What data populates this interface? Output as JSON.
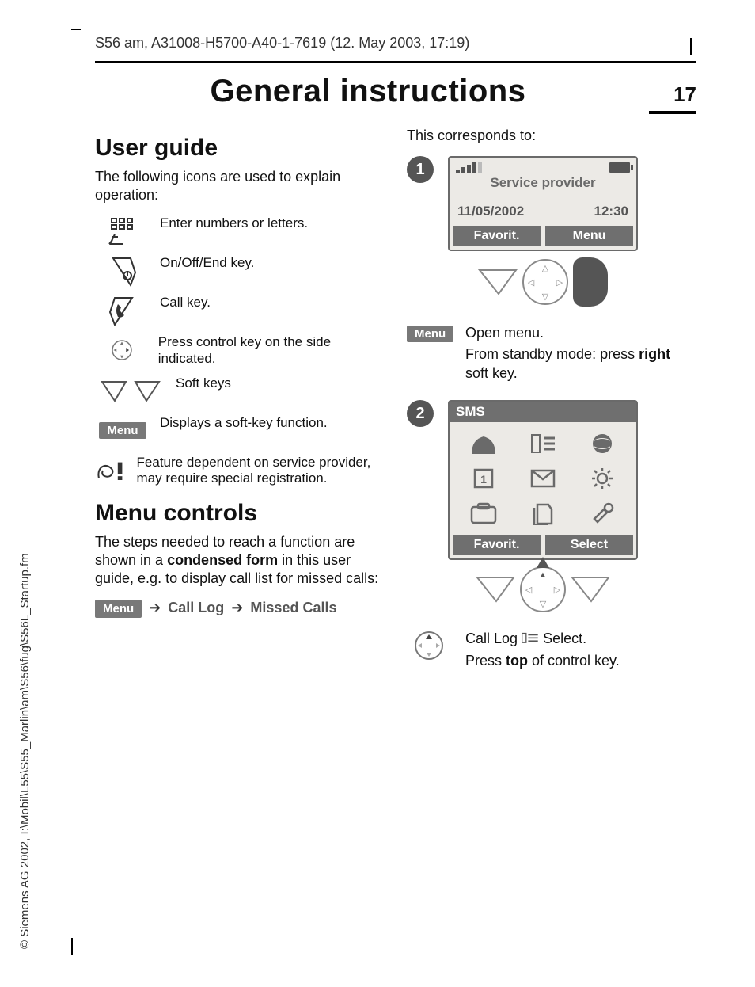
{
  "running_head": "S56 am, A31008-H5700-A40-1-7619 (12. May 2003, 17:19)",
  "title": "General instructions",
  "page_number": "17",
  "side_copyright": "© Siemens AG 2002, I:\\Mobil\\L55\\S55_Marlin\\am\\S56\\fug\\S56L_Startup.fm",
  "left": {
    "h_user_guide": "User guide",
    "intro": "The following icons are used to explain operation:",
    "icons": [
      {
        "name": "keypad-icon",
        "desc": "Enter numbers or letters."
      },
      {
        "name": "end-key-icon",
        "desc": "On/Off/End key."
      },
      {
        "name": "call-key-icon",
        "desc": "Call key."
      },
      {
        "name": "control-key-icon",
        "desc": "Press control key on the side indicated."
      },
      {
        "name": "soft-keys-icon",
        "desc": "Soft keys"
      },
      {
        "name": "menu-pill",
        "desc": "Displays a soft-key function.",
        "pill": "Menu"
      },
      {
        "name": "provider-icon",
        "desc": "Feature dependent on service provider, may require special registration."
      }
    ],
    "h_menu_controls": "Menu controls",
    "menu_controls_body_pre": "The steps needed to reach a function are shown in a ",
    "menu_controls_bold": "condensed form",
    "menu_controls_body_post": " in this user guide, e.g. to display call list for missed calls:",
    "nav": {
      "menu": "Menu",
      "a": "Call Log",
      "b": "Missed Calls"
    }
  },
  "right": {
    "corresponds": "This corresponds to:",
    "step1": {
      "badge": "1",
      "screen": {
        "provider": "Service provider",
        "date": "11/05/2002",
        "time": "12:30",
        "left_soft": "Favorit.",
        "right_soft": "Menu"
      }
    },
    "menu_pill": "Menu",
    "menu_line1": "Open menu.",
    "menu_line2_pre": "From standby mode: press ",
    "menu_line2_bold": "right",
    "menu_line2_post": " soft key.",
    "step2": {
      "badge": "2",
      "screen": {
        "title": "SMS",
        "left_soft": "Favorit.",
        "right_soft": "Select"
      }
    },
    "ctrl_line1_pre": "Call Log ",
    "ctrl_line1_post": " Select.",
    "ctrl_line2_pre": "Press ",
    "ctrl_line2_bold": "top",
    "ctrl_line2_post": " of control key."
  }
}
